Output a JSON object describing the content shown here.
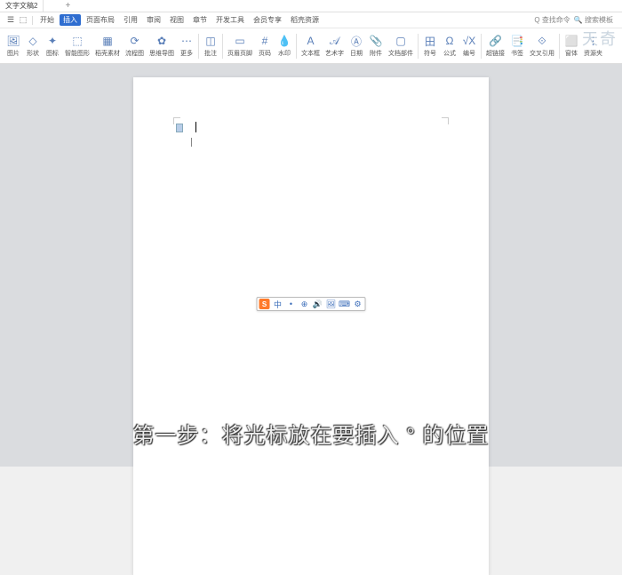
{
  "title": "文字文稿2",
  "menu": {
    "items": [
      "开始",
      "插入",
      "页面布局",
      "引用",
      "审阅",
      "视图",
      "章节",
      "开发工具",
      "会员专享",
      "稻壳资源"
    ],
    "active_index": 1,
    "quick_command": "查找命令",
    "search_placeholder": "搜索模板"
  },
  "ribbon": {
    "items": [
      {
        "icon": "🖼",
        "label": "图片"
      },
      {
        "icon": "◇",
        "label": "形状"
      },
      {
        "icon": "✦",
        "label": "图标"
      },
      {
        "icon": "⬚",
        "label": "智能图形"
      },
      {
        "icon": "▦",
        "label": "稻壳素材"
      },
      {
        "icon": "⟳",
        "label": "流程图"
      },
      {
        "icon": "✿",
        "label": "思维导图"
      },
      {
        "icon": "⋯",
        "label": "更多"
      },
      {
        "icon": "◫",
        "label": "批注"
      },
      {
        "icon": "▭",
        "label": "页眉页脚"
      },
      {
        "icon": "#",
        "label": "页码"
      },
      {
        "icon": "💧",
        "label": "水印"
      },
      {
        "icon": "A",
        "label": "文本框"
      },
      {
        "icon": "𝒜",
        "label": "艺术字"
      },
      {
        "icon": "Ⓐ",
        "label": "日期"
      },
      {
        "icon": "📎",
        "label": "附件"
      },
      {
        "icon": "▢",
        "label": "文档部件"
      },
      {
        "icon": "田",
        "label": "符号"
      },
      {
        "icon": "Ω",
        "label": "公式"
      },
      {
        "icon": "√X",
        "label": "编号"
      },
      {
        "icon": "🔗",
        "label": "超链接"
      },
      {
        "icon": "📑",
        "label": "书签"
      },
      {
        "icon": "⟐",
        "label": "交叉引用"
      },
      {
        "icon": "⬜",
        "label": "窗体"
      },
      {
        "icon": "⋮",
        "label": "资源夹"
      }
    ]
  },
  "ime": {
    "logo": "S",
    "items": [
      "中",
      "•",
      "⊕",
      "🔊",
      "🖼",
      "⌨",
      "⚙"
    ]
  },
  "caption": "第一步：将光标放在要插入 ° 的位置",
  "watermark": "天奇"
}
